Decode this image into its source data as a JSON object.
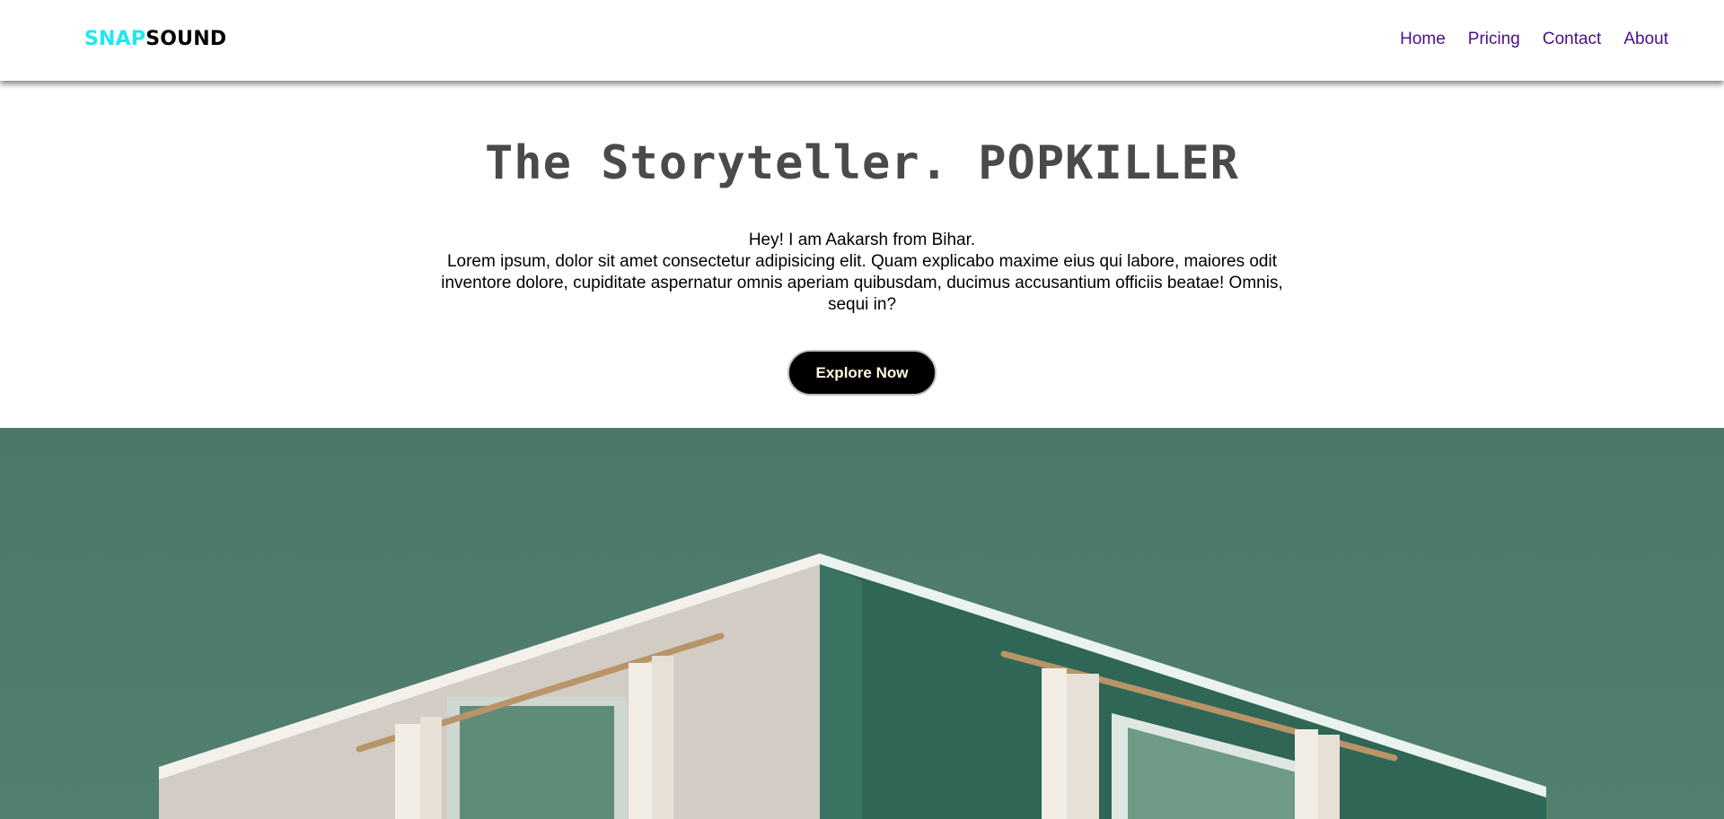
{
  "brand": {
    "part1": "SNAP",
    "part2": "SOUND"
  },
  "nav": {
    "items": [
      "Home",
      "Pricing",
      "Contact",
      "About"
    ]
  },
  "hero": {
    "title": "The Storyteller. POPKILLER",
    "greeting": "Hey! I am Aakarsh from Bihar.",
    "body": "Lorem ipsum, dolor sit amet consectetur adipisicing elit. Quam explicabo maxime eius qui labore, maiores odit inventore dolore, cupiditate aspernatur omnis aperiam quibusdam, ducimus accusantium officiis beatae! Omnis, sequi in?",
    "cta_label": "Explore Now"
  },
  "colors": {
    "brand_accent": "#1ee8f0",
    "nav_link": "#4b0f8c",
    "title": "#4a4a4a",
    "image_background": "#4e7b6c"
  }
}
